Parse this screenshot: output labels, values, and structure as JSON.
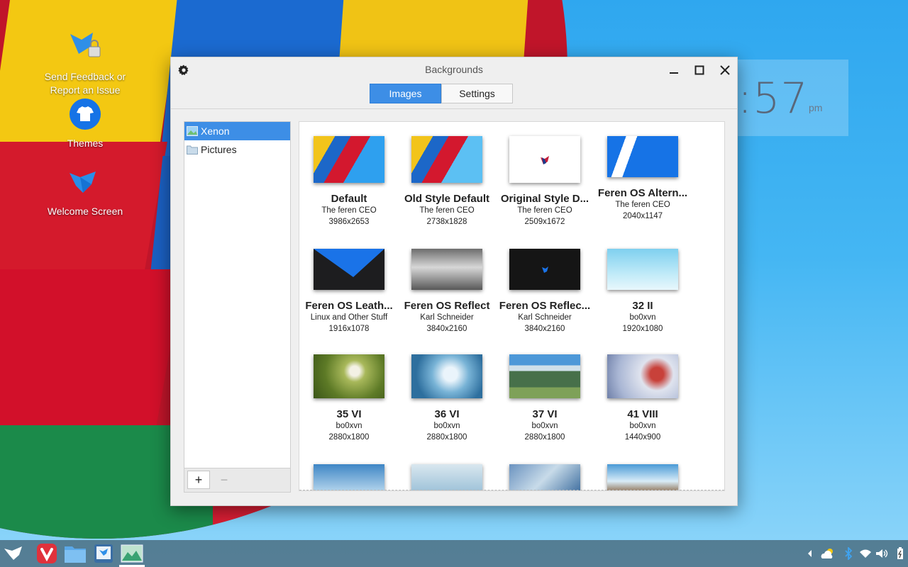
{
  "desktop": {
    "icons": [
      {
        "label": "Send Feedback or Report an Issue"
      },
      {
        "label": "Themes"
      },
      {
        "label": "Welcome Screen"
      }
    ],
    "clock": {
      "time": ":57",
      "ampm": "pm"
    }
  },
  "window": {
    "title": "Backgrounds",
    "tabs": [
      {
        "label": "Images"
      },
      {
        "label": "Settings"
      }
    ],
    "sidebar": {
      "items": [
        {
          "label": "Xenon"
        },
        {
          "label": "Pictures"
        }
      ],
      "add_label": "+",
      "remove_label": "−"
    },
    "wallpapers": [
      {
        "name": "Default",
        "author": "The feren CEO",
        "res": "3986x2653"
      },
      {
        "name": "Old Style Default",
        "author": "The feren CEO",
        "res": "2738x1828"
      },
      {
        "name": "Original Style D...",
        "author": "The feren CEO",
        "res": "2509x1672"
      },
      {
        "name": "Feren OS Altern...",
        "author": "The feren CEO",
        "res": "2040x1147"
      },
      {
        "name": "Feren OS Leath...",
        "author": "Linux and Other Stuff",
        "res": "1916x1078"
      },
      {
        "name": "Feren OS Reflect",
        "author": "Karl Schneider",
        "res": "3840x2160"
      },
      {
        "name": "Feren OS Reflec...",
        "author": "Karl Schneider",
        "res": "3840x2160"
      },
      {
        "name": "32 II",
        "author": "bo0xvn",
        "res": "1920x1080"
      },
      {
        "name": "35 VI",
        "author": "bo0xvn",
        "res": "2880x1800"
      },
      {
        "name": "36 VI",
        "author": "bo0xvn",
        "res": "2880x1800"
      },
      {
        "name": "37 VI",
        "author": "bo0xvn",
        "res": "2880x1800"
      },
      {
        "name": "41 VIII",
        "author": "bo0xvn",
        "res": "1440x900"
      }
    ]
  },
  "colors": {
    "accent": "#3d8ee6"
  }
}
